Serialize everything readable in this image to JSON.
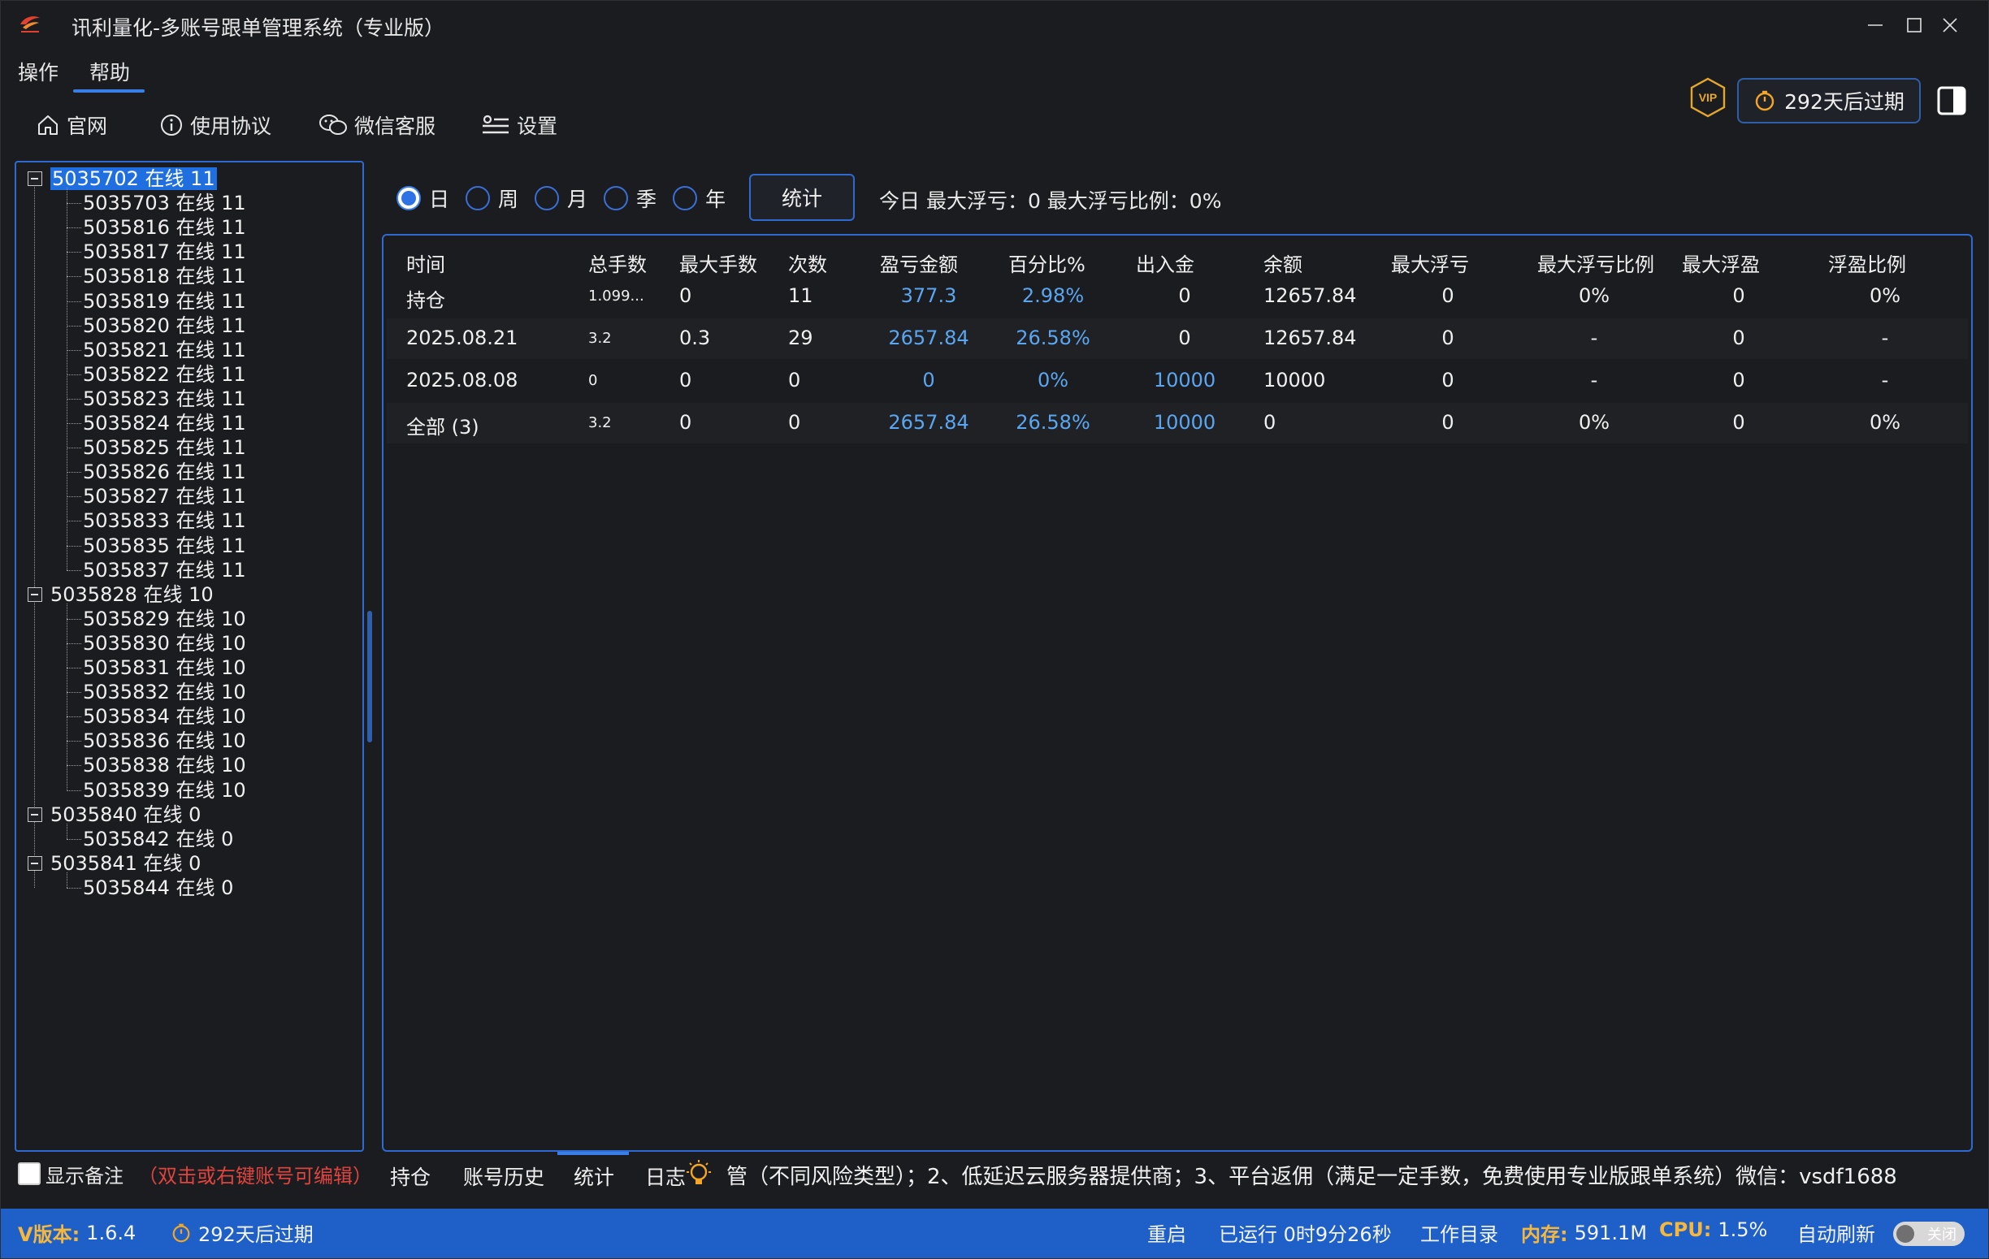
{
  "window": {
    "title": "讯利量化-多账号跟单管理系统（专业版）"
  },
  "menu": [
    "操作",
    "帮助"
  ],
  "toolbar": {
    "items": [
      "官网",
      "使用协议",
      "微信客服",
      "设置"
    ],
    "vip_label": "VIP",
    "expire": "292天后过期"
  },
  "tree": {
    "groups": [
      {
        "label": "5035702 在线 11",
        "selected": true,
        "children": [
          "5035703 在线 11",
          "5035816 在线 11",
          "5035817 在线 11",
          "5035818 在线 11",
          "5035819 在线 11",
          "5035820 在线 11",
          "5035821 在线 11",
          "5035822 在线 11",
          "5035823 在线 11",
          "5035824 在线 11",
          "5035825 在线 11",
          "5035826 在线 11",
          "5035827 在线 11",
          "5035833 在线 11",
          "5035835 在线 11",
          "5035837 在线 11"
        ]
      },
      {
        "label": "5035828 在线 10",
        "children": [
          "5035829 在线 10",
          "5035830 在线 10",
          "5035831 在线 10",
          "5035832 在线 10",
          "5035834 在线 10",
          "5035836 在线 10",
          "5035838 在线 10",
          "5035839 在线 10"
        ]
      },
      {
        "label": "5035840 在线 0",
        "children": [
          "5035842 在线 0"
        ]
      },
      {
        "label": "5035841 在线 0",
        "children": [
          "5035844 在线 0"
        ]
      }
    ],
    "show_notes": "显示备注",
    "hint": "（双击或右键账号可编辑）"
  },
  "filters": {
    "periods": [
      "日",
      "周",
      "月",
      "季",
      "年"
    ],
    "selected_period": "日",
    "stats_button": "统计",
    "today_summary": "今日 最大浮亏：0  最大浮亏比例：0%"
  },
  "table": {
    "columns": [
      "时间",
      "总手数",
      "最大手数",
      "次数",
      "盈亏金额",
      "百分比%",
      "出入金",
      "余额",
      "最大浮亏",
      "最大浮亏比例",
      "最大浮盈",
      "浮盈比例"
    ],
    "rows": [
      [
        "持仓",
        "1.099...",
        "0",
        "11",
        "377.3",
        "2.98%",
        "0",
        "12657.84",
        "0",
        "0%",
        "0",
        "0%"
      ],
      [
        "2025.08.21",
        "3.2",
        "0.3",
        "29",
        "2657.84",
        "26.58%",
        "0",
        "12657.84",
        "0",
        "-",
        "0",
        "-"
      ],
      [
        "2025.08.08",
        "0",
        "0",
        "0",
        "0",
        "0%",
        "10000",
        "10000",
        "0",
        "-",
        "0",
        "-"
      ],
      [
        "全部 (3)",
        "3.2",
        "0",
        "0",
        "2657.84",
        "26.58%",
        "10000",
        "0",
        "0",
        "0%",
        "0",
        "0%"
      ]
    ]
  },
  "bottom_tabs": [
    "持仓",
    "账号历史",
    "统计",
    "日志"
  ],
  "marquee": "管（不同风险类型）；2、低延迟云服务器提供商；3、平台返佣（满足一定手数，免费使用专业版跟单系统）微信：vsdf1688",
  "status": {
    "version_label": "V版本:",
    "version": "1.6.4",
    "expire": "292天后过期",
    "restart": "重启",
    "uptime": "已运行 0时9分26秒",
    "workdir": "工作目录",
    "memory_label": "内存:",
    "memory": "591.1M",
    "cpu_label": "CPU:",
    "cpu": "1.5%",
    "auto_refresh": "自动刷新",
    "toggle": "关闭"
  },
  "colors": {
    "accent": "#2f6ad0",
    "value_blue": "#5ba6f0",
    "status_bar": "#1e5fc8",
    "hint_red": "#e0443e"
  }
}
